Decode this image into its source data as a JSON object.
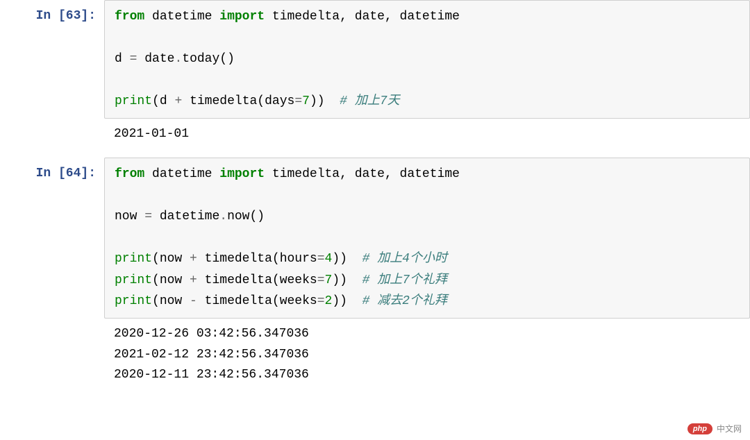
{
  "cells": [
    {
      "prompt": "In [63]:",
      "code_html": "<span class='kw-green'>from</span> <span class='name'>datetime</span> <span class='kw-green'>import</span> <span class='name'>timedelta, date, datetime</span>\n\n<span class='name'>d</span> <span class='op'>=</span> <span class='name'>date</span><span class='op'>.</span><span class='name'>today</span><span class='paren'>()</span>\n\n<span class='builtin'>print</span><span class='paren'>(</span><span class='name'>d</span> <span class='op'>+</span> <span class='name'>timedelta</span><span class='paren'>(</span><span class='name'>days</span><span class='op'>=</span><span class='num'>7</span><span class='paren'>))</span>  <span class='comment'># 加上7天</span>",
      "output": "2021-01-01"
    },
    {
      "prompt": "In [64]:",
      "code_html": "<span class='kw-green'>from</span> <span class='name'>datetime</span> <span class='kw-green'>import</span> <span class='name'>timedelta, date, datetime</span>\n\n<span class='name'>now</span> <span class='op'>=</span> <span class='name'>datetime</span><span class='op'>.</span><span class='name'>now</span><span class='paren'>()</span>\n\n<span class='builtin'>print</span><span class='paren'>(</span><span class='name'>now</span> <span class='op'>+</span> <span class='name'>timedelta</span><span class='paren'>(</span><span class='name'>hours</span><span class='op'>=</span><span class='num'>4</span><span class='paren'>))</span>  <span class='comment'># 加上4个小时</span>\n<span class='builtin'>print</span><span class='paren'>(</span><span class='name'>now</span> <span class='op'>+</span> <span class='name'>timedelta</span><span class='paren'>(</span><span class='name'>weeks</span><span class='op'>=</span><span class='num'>7</span><span class='paren'>))</span>  <span class='comment'># 加上7个礼拜</span>\n<span class='builtin'>print</span><span class='paren'>(</span><span class='name'>now</span> <span class='op'>-</span> <span class='name'>timedelta</span><span class='paren'>(</span><span class='name'>weeks</span><span class='op'>=</span><span class='num'>2</span><span class='paren'>))</span>  <span class='comment'># 减去2个礼拜</span>",
      "output": "2020-12-26 03:42:56.347036\n2021-02-12 23:42:56.347036\n2020-12-11 23:42:56.347036"
    }
  ],
  "watermark": {
    "pill": "php",
    "text": "中文网"
  }
}
